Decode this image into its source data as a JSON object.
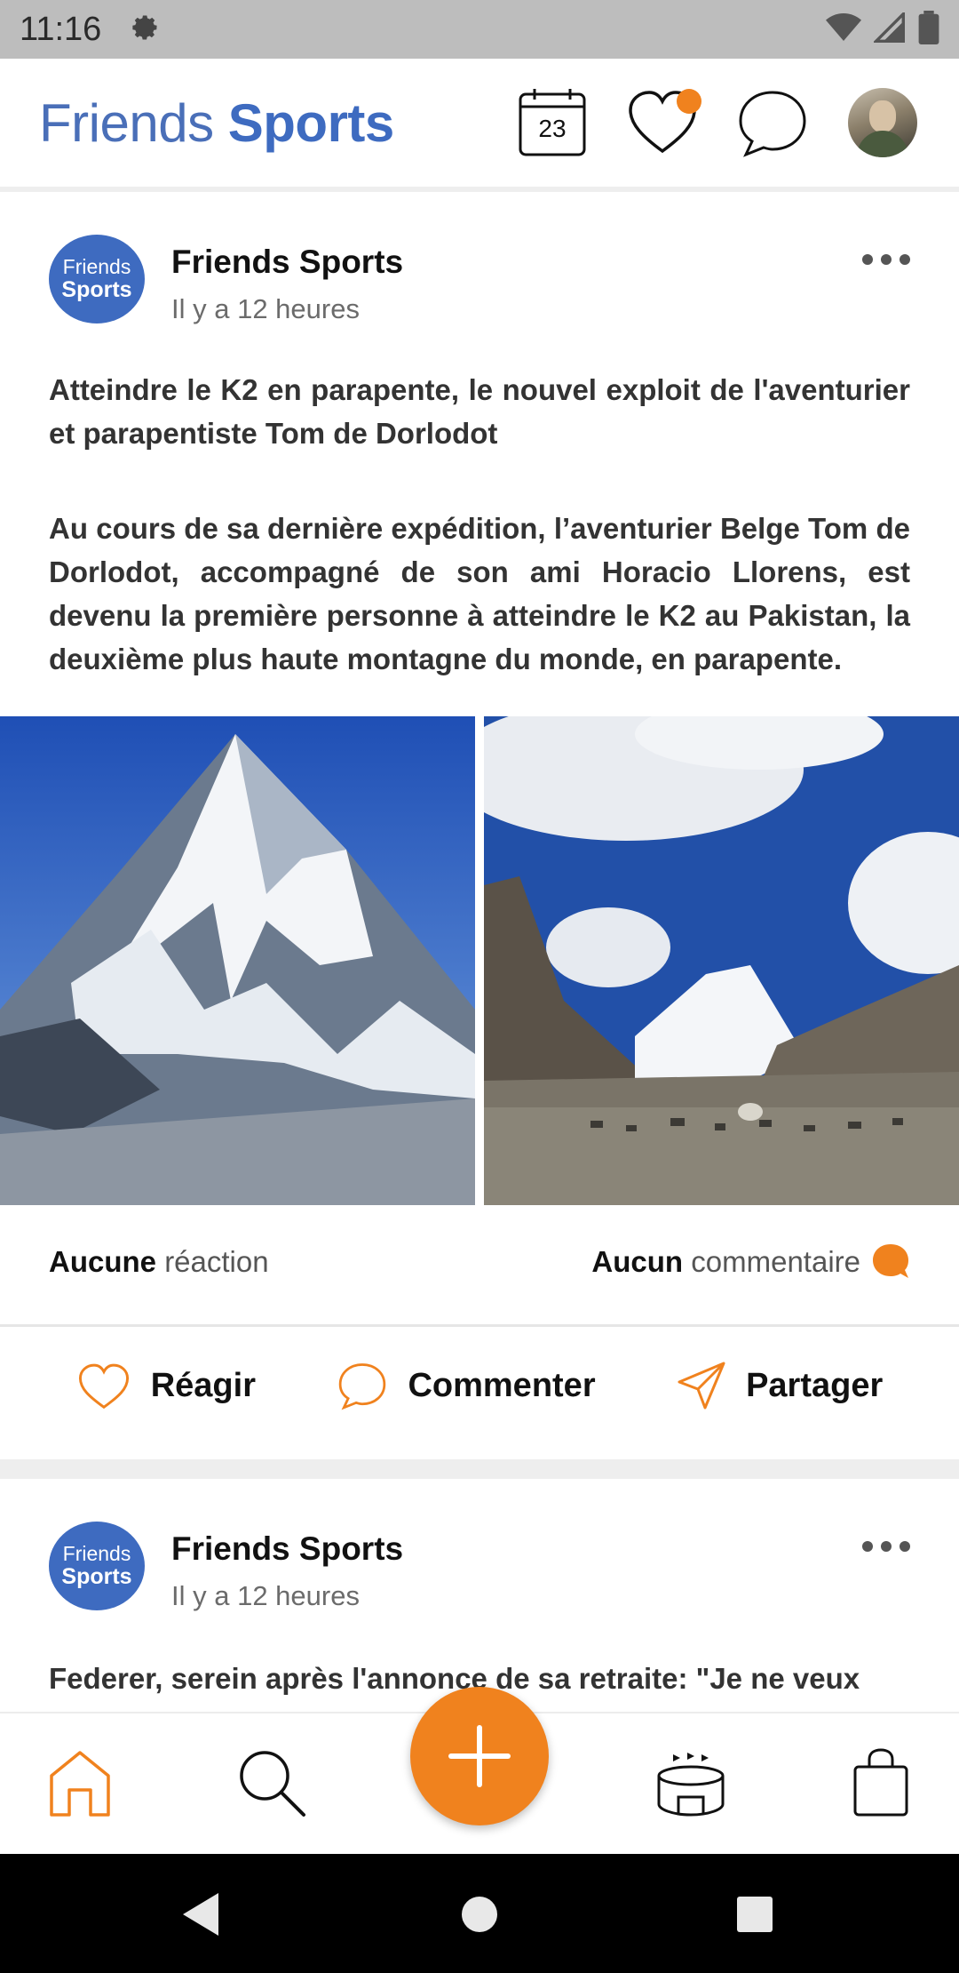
{
  "status_bar": {
    "time": "11:16",
    "icons": [
      "gear-icon",
      "wifi-icon",
      "signal-icon",
      "battery-icon"
    ]
  },
  "header": {
    "logo_light": "Friends",
    "logo_bold": "Sports",
    "calendar_day": "23",
    "colors": {
      "brand_blue": "#3e6bc0",
      "accent_orange": "#f0821e"
    }
  },
  "posts": [
    {
      "avatar_line1": "Friends",
      "avatar_line2": "Sports",
      "author": "Friends Sports",
      "time": "Il y a 12 heures",
      "title": "Atteindre le K2 en parapente, le nouvel exploit de l'aventurier et parapentiste Tom de Dorlodot",
      "body": "Au cours de sa dernière expédition, l’aventurier Belge Tom de Dorlodot, accompagné de son ami Horacio Llorens, est devenu la première personne à atteindre le K2 au Pakistan, la deuxième plus haute montagne du monde, en parapente.",
      "reactions_bold": "Aucune",
      "reactions_light": "réaction",
      "comments_bold": "Aucun",
      "comments_light": "commentaire",
      "actions": {
        "react": "Réagir",
        "comment": "Commenter",
        "share": "Partager"
      }
    },
    {
      "avatar_line1": "Friends",
      "avatar_line2": "Sports",
      "author": "Friends Sports",
      "time": "Il y a 12 heures",
      "title": "Federer, serein après l'annonce de sa retraite: \"Je ne veux"
    }
  ],
  "bottom_nav": {
    "items": [
      "home-icon",
      "search-icon",
      "add-icon",
      "stadium-icon",
      "shopping-bag-icon"
    ]
  }
}
